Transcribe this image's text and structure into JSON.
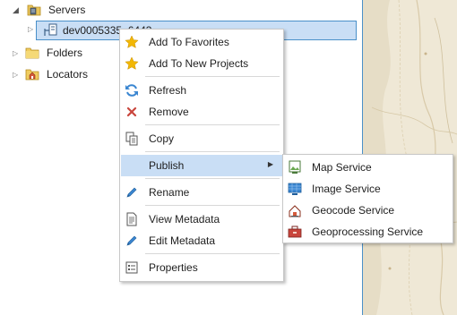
{
  "tree": {
    "servers_label": "Servers",
    "server_node_label": "dev0005335_6443",
    "folders_label": "Folders",
    "locators_label": "Locators"
  },
  "context_menu": {
    "items": [
      {
        "label": "Add To Favorites",
        "icon": "star-icon"
      },
      {
        "label": "Add To New Projects",
        "icon": "star-icon"
      },
      {
        "label": "Refresh",
        "icon": "refresh-icon"
      },
      {
        "label": "Remove",
        "icon": "remove-x-icon"
      },
      {
        "label": "Copy",
        "icon": "copy-icon"
      },
      {
        "label": "Publish",
        "icon": "submenu-arrow-icon"
      },
      {
        "label": "Rename",
        "icon": "pencil-icon"
      },
      {
        "label": "View Metadata",
        "icon": "document-icon"
      },
      {
        "label": "Edit Metadata",
        "icon": "pencil-icon"
      },
      {
        "label": "Properties",
        "icon": "properties-icon"
      }
    ]
  },
  "publish_submenu": {
    "items": [
      {
        "label": "Map Service",
        "icon": "map-service-icon"
      },
      {
        "label": "Image Service",
        "icon": "image-service-icon"
      },
      {
        "label": "Geocode Service",
        "icon": "geocode-service-icon"
      },
      {
        "label": "Geoprocessing Service",
        "icon": "geoprocessing-service-icon"
      }
    ]
  },
  "colors": {
    "selection_bg": "#c9def5",
    "selection_border": "#4a90c9",
    "star": "#f2b705",
    "refresh": "#3a86d1",
    "remove": "#c9463d"
  }
}
